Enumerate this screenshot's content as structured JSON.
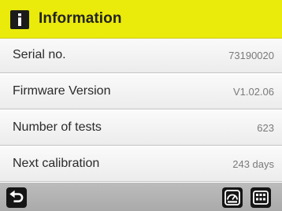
{
  "header": {
    "icon": "info-icon",
    "title": "Information",
    "color": "#eaeb0a"
  },
  "rows": [
    {
      "label": "Serial no.",
      "value": "73190020"
    },
    {
      "label": "Firmware Version",
      "value": "V1.02.06"
    },
    {
      "label": "Number of tests",
      "value": "623"
    },
    {
      "label": "Next calibration",
      "value": "243 days"
    }
  ],
  "footer": {
    "back_icon": "back-arrow-icon",
    "gauge_icon": "gauge-icon",
    "menu_icon": "grid-menu-icon"
  }
}
